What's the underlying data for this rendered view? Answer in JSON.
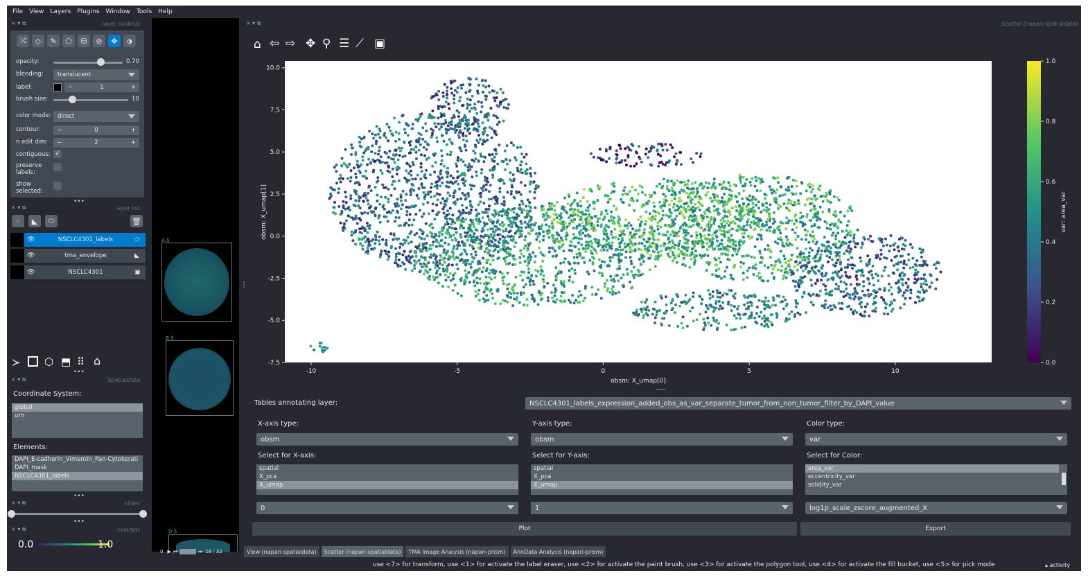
{
  "menu": [
    "File",
    "View",
    "Layers",
    "Plugins",
    "Window",
    "Tools",
    "Help"
  ],
  "docks": {
    "layer_controls": "layer controls",
    "layer_list": "layer list",
    "spatialdata": "SpatialData",
    "slider": "slider",
    "colorbar": "colorbar",
    "scatter": "Scatter (napari-spatialdata)",
    "dock_symbols": "× ▾ ⧉"
  },
  "layer_controls": {
    "opacity_label": "opacity:",
    "opacity_value": "0.70",
    "opacity_fraction": 0.7,
    "blending_label": "blending:",
    "blending_value": "translucent",
    "label_label": "label:",
    "label_value": "1",
    "brush_label": "brush size:",
    "brush_value": "10",
    "brush_fraction": 0.25,
    "color_mode_label": "color mode:",
    "color_mode_value": "direct",
    "contour_label": "contour:",
    "contour_value": "0",
    "ndim_label": "n edit dim:",
    "ndim_value": "2",
    "contiguous_label": "contiguous:",
    "preserve_label": "preserve\nlabels:",
    "show_selected_label": "show\nselected:",
    "minus": "−",
    "plus": "+"
  },
  "layers": [
    {
      "name": "NSCLC4301_labels",
      "type_icon": "⬭"
    },
    {
      "name": "tma_envelope",
      "type_icon": "◣"
    },
    {
      "name": "NSCLC4301",
      "type_icon": "▣"
    }
  ],
  "spatialdata": {
    "coordinate_label": "Coordinate System:",
    "coordinate_systems": [
      "global",
      "um"
    ],
    "elements_label": "Elements:",
    "elements": [
      "DAPI_E-cadherin_Vimentin_Pan-Cytokerati",
      "DAPI_mask",
      "NSCLC4301_labels"
    ]
  },
  "colorbar": {
    "min": "0.0",
    "max": "1.0"
  },
  "canvas": {
    "cores": [
      "A-5",
      "B-5",
      "D-5"
    ],
    "frame_current": "0",
    "frame_pos": "16",
    "frame_total": "32"
  },
  "plot_toolbar": [
    "home-icon",
    "back-icon",
    "forward-icon",
    "pan-icon",
    "zoom-icon",
    "configure-icon",
    "edit-axes-icon",
    "save-icon"
  ],
  "chart_data": {
    "type": "scatter",
    "title": "",
    "xlabel": "obsm: X_umap[0]",
    "ylabel": "obsm: X_umap[1]",
    "xlim": [
      -10.9,
      13.3
    ],
    "ylim": [
      -7.5,
      10.4
    ],
    "xticks": [
      -10,
      -5,
      0,
      5,
      10
    ],
    "yticks": [
      -7.5,
      -5.0,
      -2.5,
      0.0,
      2.5,
      5.0,
      7.5,
      10.0
    ],
    "colorbar_label": "var: area_var",
    "colorbar_ticks": [
      0.0,
      0.2,
      0.4,
      0.6,
      0.8,
      1.0
    ],
    "colormap": "viridis",
    "grid": false,
    "clusters": [
      {
        "cx": -5.8,
        "cy": 2.6,
        "rx": 3.6,
        "ry": 4.8,
        "value": 0.35
      },
      {
        "cx": -4.6,
        "cy": 7.6,
        "rx": 1.4,
        "ry": 1.8,
        "value": 0.3
      },
      {
        "cx": -2.3,
        "cy": -1.2,
        "rx": 4.2,
        "ry": 3.0,
        "value": 0.55
      },
      {
        "cx": 1.8,
        "cy": 1.0,
        "rx": 4.0,
        "ry": 2.4,
        "value": 0.65
      },
      {
        "cx": 5.2,
        "cy": 0.5,
        "rx": 3.6,
        "ry": 3.2,
        "value": 0.6
      },
      {
        "cx": 9.0,
        "cy": -2.3,
        "rx": 2.6,
        "ry": 2.5,
        "value": 0.35
      },
      {
        "cx": 1.5,
        "cy": 4.8,
        "rx": 2.0,
        "ry": 0.7,
        "value": 0.2
      },
      {
        "cx": 4.0,
        "cy": -4.4,
        "rx": 3.0,
        "ry": 1.2,
        "value": 0.45
      },
      {
        "cx": -9.8,
        "cy": -6.6,
        "rx": 0.5,
        "ry": 0.3,
        "value": 0.5
      }
    ]
  },
  "table_row": {
    "label": "Tables annotating layer:",
    "value": "NSCLC4301_labels_expression_added_obs_as_var_separate_tumor_from_non_tumor_filter_by_DAPI_value"
  },
  "x_axis": {
    "type_label": "X-axis type:",
    "type_value": "obsm",
    "select_label": "Select for X-axis:",
    "options": [
      "spatial",
      "X_pca",
      "X_umap"
    ],
    "selected": 2,
    "dim_value": "0"
  },
  "y_axis": {
    "type_label": "Y-axis type:",
    "type_value": "obsm",
    "select_label": "Select for Y-axis:",
    "options": [
      "spatial",
      "X_pca",
      "X_umap"
    ],
    "selected": 2,
    "dim_value": "1"
  },
  "color": {
    "type_label": "Color type:",
    "type_value": "var",
    "select_label": "Select for Color:",
    "options": [
      "area_var",
      "eccentricity_var",
      "solidity_var"
    ],
    "selected": 0,
    "layer_value": "log1p_scale_zscore_augmented_X"
  },
  "buttons": {
    "plot": "Plot",
    "export": "Export"
  },
  "tabs": [
    "View (napari-spatialdata)",
    "Scatter (napari-spatialdata)",
    "TMA Image Analysis (napari-prism)",
    "AnnData Analysis (napari-prism)"
  ],
  "active_tab": 1,
  "status": {
    "message": "use <7> for transform, use <1> for activate the label eraser, use <2> for activate the paint brush, use <3> for activate the polygon tool, use <4> for activate the fill bucket, use <5> for pick mode",
    "activity": "▴ activity"
  }
}
